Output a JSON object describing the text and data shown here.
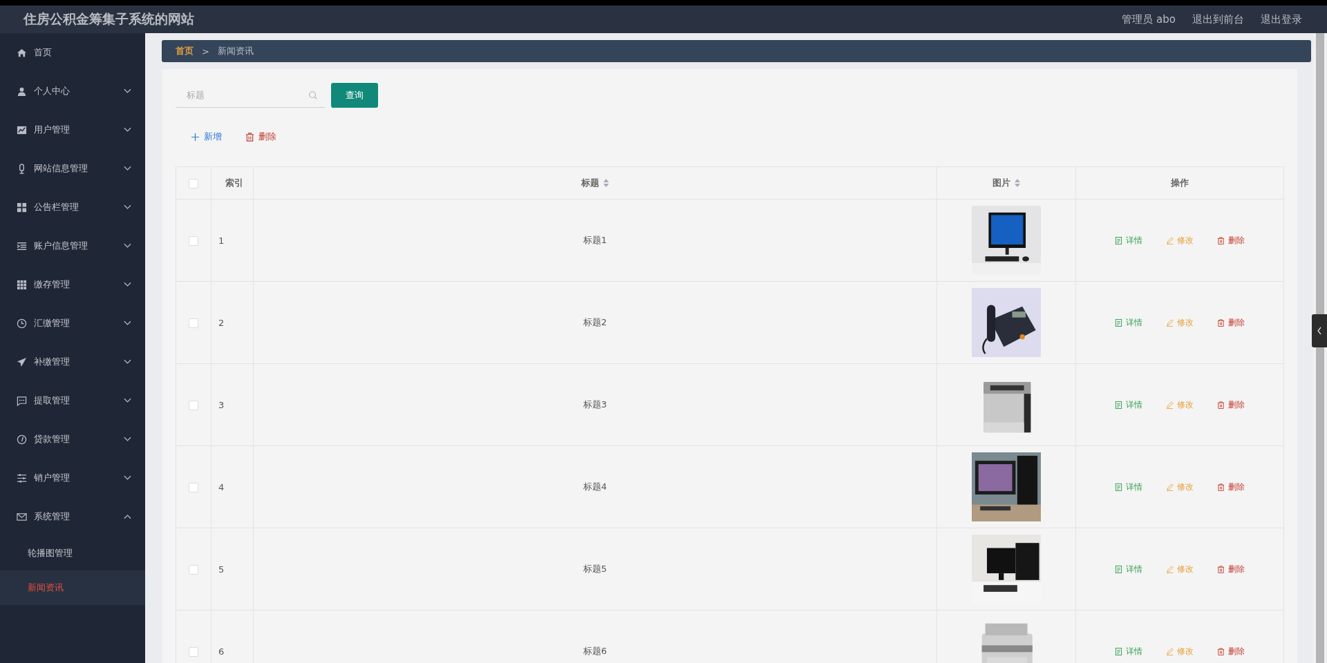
{
  "header": {
    "title": "住房公积金筹集子系统的网站",
    "links": [
      "管理员 abo",
      "退出到前台",
      "退出登录"
    ]
  },
  "sidebar": {
    "items": [
      {
        "label": "首页"
      },
      {
        "label": "个人中心",
        "expanded": false
      },
      {
        "label": "用户管理",
        "expanded": false
      },
      {
        "label": "网站信息管理",
        "expanded": false
      },
      {
        "label": "公告栏管理",
        "expanded": false
      },
      {
        "label": "账户信息管理",
        "expanded": false
      },
      {
        "label": "缴存管理",
        "expanded": false
      },
      {
        "label": "汇缴管理",
        "expanded": false
      },
      {
        "label": "补缴管理",
        "expanded": false
      },
      {
        "label": "提取管理",
        "expanded": false
      },
      {
        "label": "贷款管理",
        "expanded": false
      },
      {
        "label": "销户管理",
        "expanded": false
      },
      {
        "label": "系统管理",
        "expanded": true,
        "children": [
          {
            "label": "轮播图管理",
            "selected": false
          },
          {
            "label": "新闻资讯",
            "selected": true
          }
        ]
      }
    ]
  },
  "breadcrumb": {
    "items": [
      "首页",
      "新闻资讯"
    ],
    "separator": ">"
  },
  "search": {
    "placeholder": "标题",
    "button": "查询"
  },
  "toolbar": [
    {
      "kind": "add",
      "label": "新增"
    },
    {
      "kind": "delete",
      "label": "删除"
    }
  ],
  "table": {
    "select_all": false,
    "columns": [
      {
        "label": "索引",
        "sortable": false
      },
      {
        "label": "标题",
        "sortable": true
      },
      {
        "label": "图片",
        "sortable": true
      },
      {
        "label": "操作",
        "sortable": false
      }
    ],
    "rows": [
      {
        "checked": false,
        "index": "1",
        "title": "标题1",
        "picture": {
          "kind": "picture"
        },
        "actions": [
          {
            "kind": "detail",
            "label": "详情"
          },
          {
            "kind": "edit",
            "label": "修改"
          },
          {
            "kind": "delete",
            "label": "删除"
          }
        ]
      },
      {
        "checked": false,
        "index": "2",
        "title": "标题2",
        "picture": {
          "kind": "picture"
        },
        "actions": [
          {
            "kind": "detail",
            "label": "详情"
          },
          {
            "kind": "edit",
            "label": "修改"
          },
          {
            "kind": "delete",
            "label": "删除"
          }
        ]
      },
      {
        "checked": false,
        "index": "3",
        "title": "标题3",
        "picture": {
          "kind": "picture"
        },
        "actions": [
          {
            "kind": "detail",
            "label": "详情"
          },
          {
            "kind": "edit",
            "label": "修改"
          },
          {
            "kind": "delete",
            "label": "删除"
          }
        ]
      },
      {
        "checked": false,
        "index": "4",
        "title": "标题4",
        "picture": {
          "kind": "picture"
        },
        "actions": [
          {
            "kind": "detail",
            "label": "详情"
          },
          {
            "kind": "edit",
            "label": "修改"
          },
          {
            "kind": "delete",
            "label": "删除"
          }
        ]
      },
      {
        "checked": false,
        "index": "5",
        "title": "标题5",
        "picture": {
          "kind": "picture"
        },
        "actions": [
          {
            "kind": "detail",
            "label": "详情"
          },
          {
            "kind": "edit",
            "label": "修改"
          },
          {
            "kind": "delete",
            "label": "删除"
          }
        ]
      },
      {
        "checked": false,
        "index": "6",
        "title": "标题6",
        "picture": {
          "kind": "picture"
        },
        "actions": [
          {
            "kind": "detail",
            "label": "详情"
          },
          {
            "kind": "edit",
            "label": "修改"
          },
          {
            "kind": "delete",
            "label": "删除"
          }
        ]
      }
    ]
  }
}
